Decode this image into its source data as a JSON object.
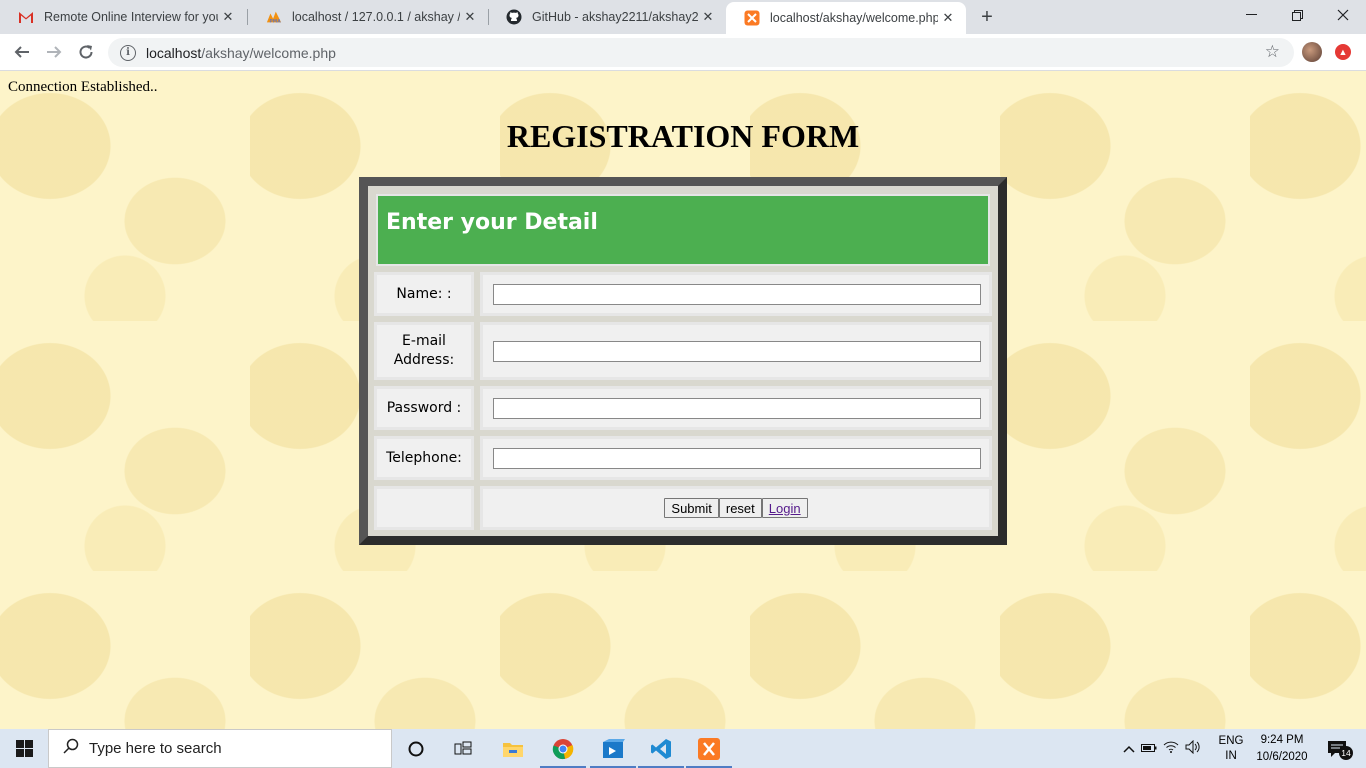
{
  "browser": {
    "tabs": [
      {
        "title": "Remote Online Interview for your",
        "icon": "gmail-icon",
        "active": false
      },
      {
        "title": "localhost / 127.0.0.1 / akshay / re",
        "icon": "phpmyadmin-icon",
        "active": false
      },
      {
        "title": "GitHub - akshay2211/akshay221",
        "icon": "github-icon",
        "active": false
      },
      {
        "title": "localhost/akshay/welcome.php",
        "icon": "xampp-icon",
        "active": true
      }
    ],
    "url_host": "localhost",
    "url_path": "/akshay/welcome.php"
  },
  "page": {
    "status": "Connection Established..",
    "title": "REGISTRATION FORM",
    "form": {
      "header": "Enter your Detail",
      "fields": [
        {
          "label": "Name: :",
          "value": ""
        },
        {
          "label": "E-mail Address:",
          "value": ""
        },
        {
          "label": "Password :",
          "value": ""
        },
        {
          "label": "Telephone:",
          "value": ""
        }
      ],
      "submit_label": "Submit",
      "reset_label": "reset",
      "login_label": "Login"
    }
  },
  "taskbar": {
    "search_placeholder": "Type here to search",
    "lang_line1": "ENG",
    "lang_line2": "IN",
    "time": "9:24 PM",
    "date": "10/6/2020",
    "notification_count": "14"
  }
}
